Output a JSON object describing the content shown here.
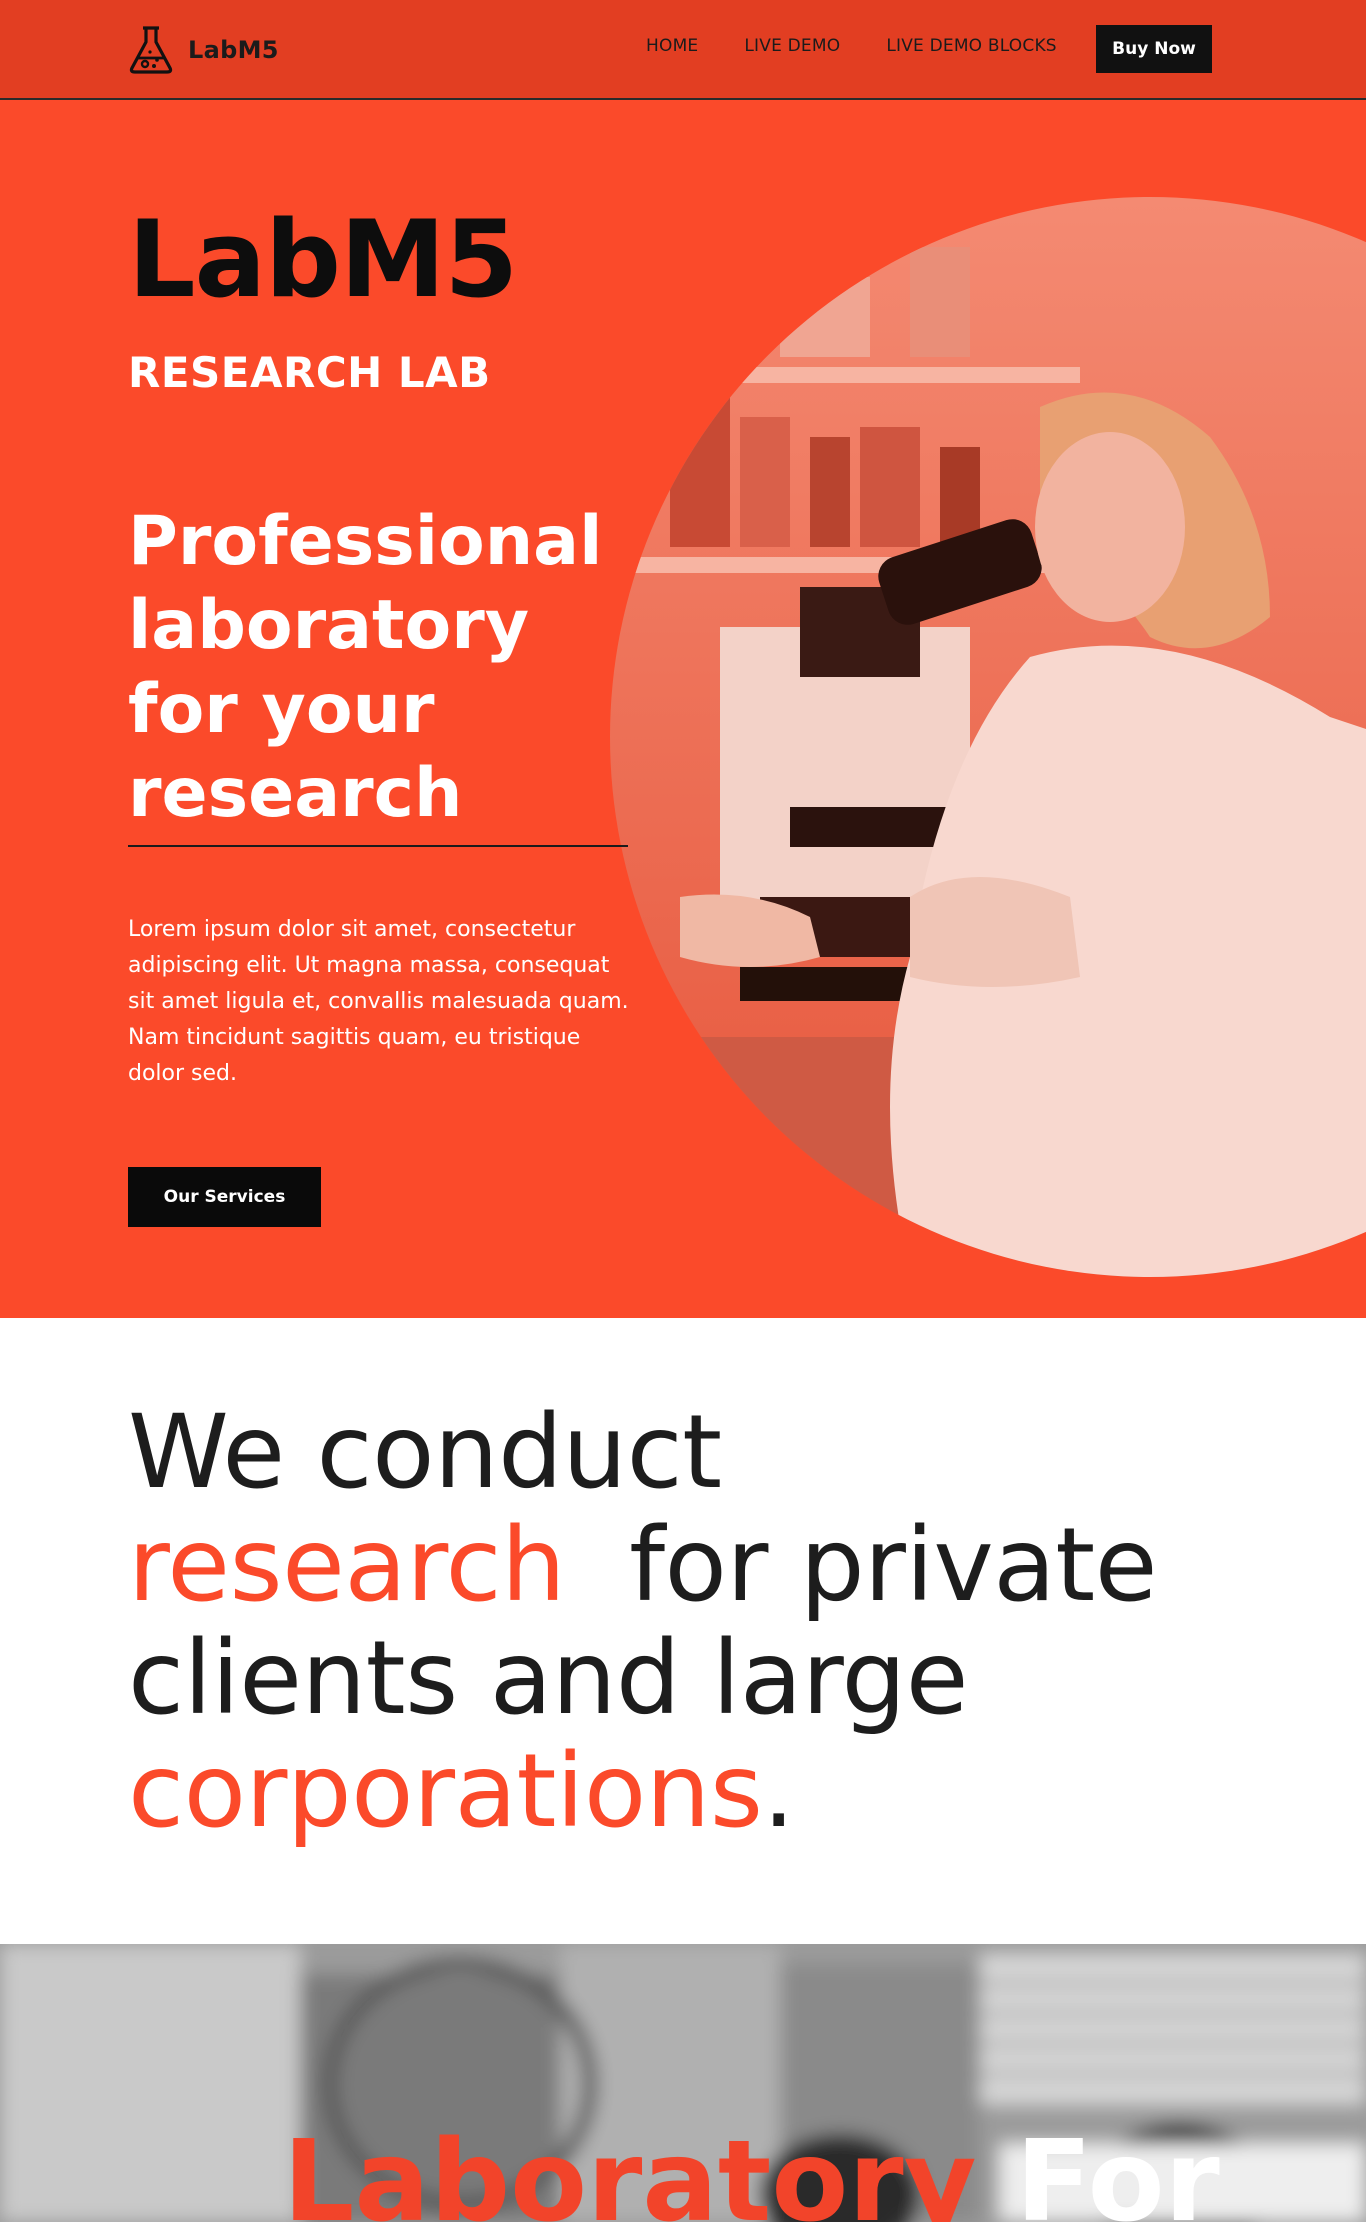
{
  "header": {
    "brand": "LabM5",
    "brand_icon": "flask-icon",
    "nav": [
      "HOME",
      "LIVE DEMO",
      "LIVE DEMO BLOCKS"
    ],
    "cta": "Buy Now"
  },
  "hero": {
    "title": "LabM5",
    "subtitle": "RESEARCH LAB",
    "headline": "Professional laboratory for your research",
    "description": "Lorem ipsum dolor sit amet, consectetur adipiscing elit. Ut magna massa, consequat sit amet ligula et, convallis malesuada quam. Nam tincidunt sagittis quam, eu tristique dolor sed.",
    "button": "Our Services"
  },
  "statement": {
    "part1": "We conduct",
    "accent1": "research",
    "part2": "for private clients and large",
    "accent2": "corporations",
    "end": "."
  },
  "banner": {
    "accent": "Laboratory",
    "plain": "For"
  },
  "colors": {
    "header_bg": "#e23e22",
    "hero_bg": "#fb4a2a",
    "accent": "#fb4a2a",
    "dark": "#0d0d0d"
  }
}
